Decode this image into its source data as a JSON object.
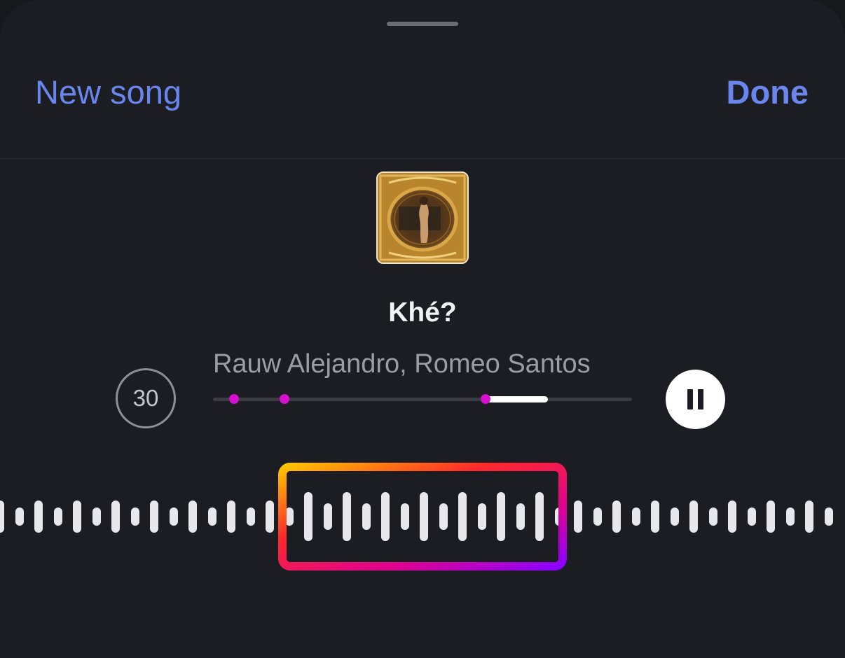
{
  "header": {
    "left_label": "New song",
    "right_label": "Done"
  },
  "track": {
    "title": "Khé?",
    "artist": "Rauw Alejandro, Romeo Santos",
    "cover_icon": "album-cover"
  },
  "controls": {
    "skip_label": "30",
    "play_state": "pause-icon",
    "progress_fraction_start": 0.65,
    "progress_fraction_end": 0.8,
    "marker_fractions": [
      0.05,
      0.17,
      0.65
    ]
  },
  "colors": {
    "accent": "#6a86ee",
    "marker": "#d60fd1",
    "selector_gradient": [
      "#ffc400",
      "#ff2a2a",
      "#e10090",
      "#8a00ff"
    ]
  }
}
